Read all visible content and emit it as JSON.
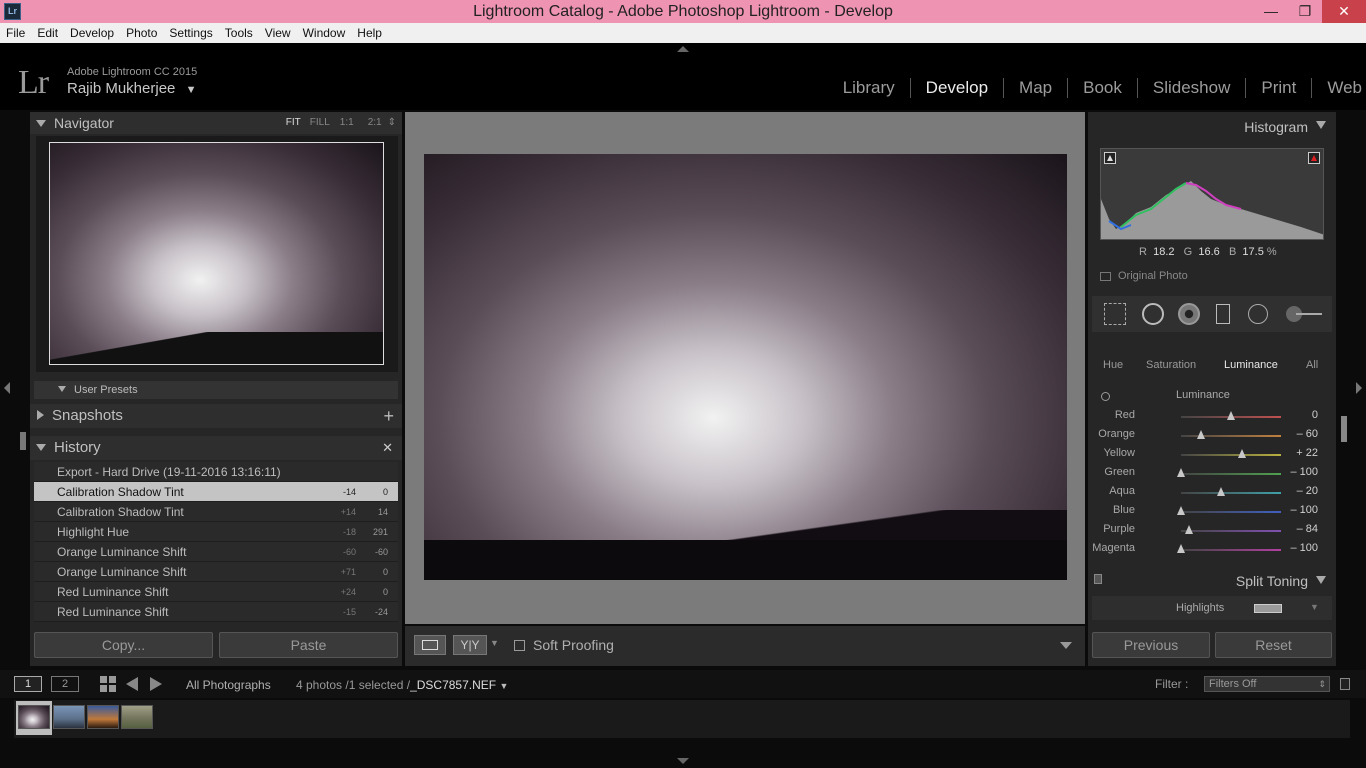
{
  "window": {
    "title": "Lightroom Catalog - Adobe Photoshop Lightroom - Develop",
    "icon": "Lr"
  },
  "menu": [
    "File",
    "Edit",
    "Develop",
    "Photo",
    "Settings",
    "Tools",
    "View",
    "Window",
    "Help"
  ],
  "identity": {
    "logo": "Lr",
    "product": "Adobe Lightroom CC 2015",
    "user": "Rajib Mukherjee"
  },
  "modules": [
    "Library",
    "Develop",
    "Map",
    "Book",
    "Slideshow",
    "Print",
    "Web"
  ],
  "active_module": "Develop",
  "navigator": {
    "title": "Navigator",
    "zoom": [
      "FIT",
      "FILL",
      "1:1",
      "2:1"
    ]
  },
  "left_panels": {
    "user_presets": "User Presets",
    "snapshots": "Snapshots",
    "history": "History"
  },
  "history": [
    {
      "label": "Export - Hard Drive (19-11-2016 13:16:11)",
      "v1": "",
      "v2": ""
    },
    {
      "label": "Calibration Shadow Tint",
      "v1": "-14",
      "v2": "0",
      "selected": true
    },
    {
      "label": "Calibration Shadow Tint",
      "v1": "+14",
      "v2": "14"
    },
    {
      "label": "Highlight Hue",
      "v1": "-18",
      "v2": "291"
    },
    {
      "label": "Orange Luminance Shift",
      "v1": "-60",
      "v2": "-60"
    },
    {
      "label": "Orange Luminance Shift",
      "v1": "+71",
      "v2": "0"
    },
    {
      "label": "Red Luminance Shift",
      "v1": "+24",
      "v2": "0"
    },
    {
      "label": "Red Luminance Shift",
      "v1": "-15",
      "v2": "-24"
    }
  ],
  "left_buttons": {
    "copy": "Copy...",
    "paste": "Paste"
  },
  "toolbar": {
    "soft_proofing": "Soft Proofing",
    "yy": "Y|Y"
  },
  "histogram": {
    "title": "Histogram",
    "r_label": "R",
    "r": "18.2",
    "g_label": "G",
    "g": "16.6",
    "b_label": "B",
    "b": "17.5",
    "pct": "%",
    "original_photo": "Original Photo"
  },
  "hsl_tabs": [
    "Hue",
    "Saturation",
    "Luminance",
    "All"
  ],
  "active_hsl_tab": "Luminance",
  "luminance": {
    "title": "Luminance",
    "rows": [
      {
        "name": "Red",
        "value": "0",
        "pos": 0.5,
        "color": "#c05050"
      },
      {
        "name": "Orange",
        "value": "– 60",
        "pos": 0.2,
        "color": "#c08040"
      },
      {
        "name": "Yellow",
        "value": "+ 22",
        "pos": 0.61,
        "color": "#b8b040"
      },
      {
        "name": "Green",
        "value": "– 100",
        "pos": 0.0,
        "color": "#50a050"
      },
      {
        "name": "Aqua",
        "value": "– 20",
        "pos": 0.4,
        "color": "#40a0a8"
      },
      {
        "name": "Blue",
        "value": "– 100",
        "pos": 0.0,
        "color": "#4060c0"
      },
      {
        "name": "Purple",
        "value": "– 84",
        "pos": 0.08,
        "color": "#8050b0"
      },
      {
        "name": "Magenta",
        "value": "– 100",
        "pos": 0.0,
        "color": "#b040a0"
      }
    ]
  },
  "split_toning": {
    "title": "Split Toning",
    "highlights": "Highlights"
  },
  "right_buttons": {
    "previous": "Previous",
    "reset": "Reset"
  },
  "filmstrip": {
    "view1": "1",
    "view2": "2",
    "source": "All Photographs",
    "status": "4 photos /1 selected /",
    "file": "_DSC7857.NEF",
    "filter_label": "Filter :",
    "filter_value": "Filters Off"
  }
}
